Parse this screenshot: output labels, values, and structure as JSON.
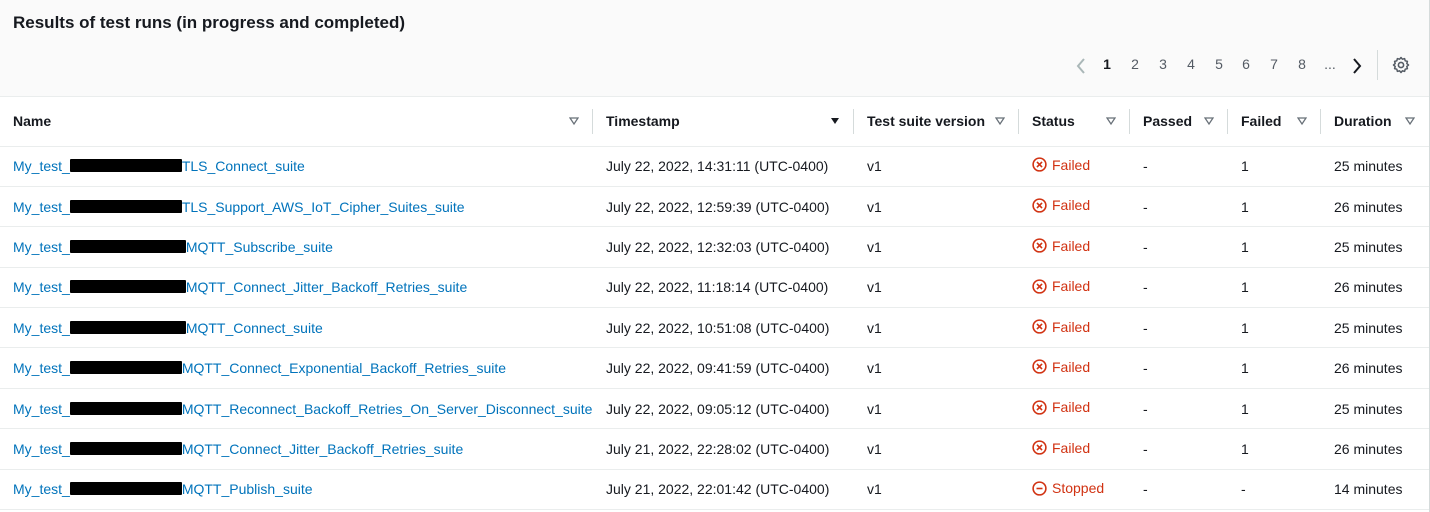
{
  "title": "Results of test runs (in progress and completed)",
  "pagination": {
    "pages": [
      "1",
      "2",
      "3",
      "4",
      "5",
      "6",
      "7",
      "8",
      "..."
    ],
    "current": "1"
  },
  "columns": {
    "name": "Name",
    "timestamp": "Timestamp",
    "version": "Test suite version",
    "status": "Status",
    "passed": "Passed",
    "failed": "Failed",
    "duration": "Duration"
  },
  "rows": [
    {
      "prefix": "My_test_",
      "suffix": "TLS_Connect_suite",
      "timestamp": "July 22, 2022, 14:31:11 (UTC-0400)",
      "version": "v1",
      "status": "Failed",
      "passed": "-",
      "failed": "1",
      "duration": "25 minutes"
    },
    {
      "prefix": "My_test_",
      "suffix": "TLS_Support_AWS_IoT_Cipher_Suites_suite",
      "timestamp": "July 22, 2022, 12:59:39 (UTC-0400)",
      "version": "v1",
      "status": "Failed",
      "passed": "-",
      "failed": "1",
      "duration": "26 minutes"
    },
    {
      "prefix": "My_test_",
      "suffix": "MQTT_Subscribe_suite",
      "timestamp": "July 22, 2022, 12:32:03 (UTC-0400)",
      "version": "v1",
      "status": "Failed",
      "passed": "-",
      "failed": "1",
      "duration": "25 minutes"
    },
    {
      "prefix": "My_test_",
      "suffix": "MQTT_Connect_Jitter_Backoff_Retries_suite",
      "timestamp": "July 22, 2022, 11:18:14 (UTC-0400)",
      "version": "v1",
      "status": "Failed",
      "passed": "-",
      "failed": "1",
      "duration": "26 minutes"
    },
    {
      "prefix": "My_test_",
      "suffix": "MQTT_Connect_suite",
      "timestamp": "July 22, 2022, 10:51:08 (UTC-0400)",
      "version": "v1",
      "status": "Failed",
      "passed": "-",
      "failed": "1",
      "duration": "25 minutes"
    },
    {
      "prefix": "My_test_",
      "suffix": "MQTT_Connect_Exponential_Backoff_Retries_suite",
      "timestamp": "July 22, 2022, 09:41:59 (UTC-0400)",
      "version": "v1",
      "status": "Failed",
      "passed": "-",
      "failed": "1",
      "duration": "26 minutes"
    },
    {
      "prefix": "My_test_",
      "suffix": "MQTT_Reconnect_Backoff_Retries_On_Server_Disconnect_suite",
      "timestamp": "July 22, 2022, 09:05:12 (UTC-0400)",
      "version": "v1",
      "status": "Failed",
      "passed": "-",
      "failed": "1",
      "duration": "25 minutes"
    },
    {
      "prefix": "My_test_",
      "suffix": "MQTT_Connect_Jitter_Backoff_Retries_suite",
      "timestamp": "July 21, 2022, 22:28:02 (UTC-0400)",
      "version": "v1",
      "status": "Failed",
      "passed": "-",
      "failed": "1",
      "duration": "26 minutes"
    },
    {
      "prefix": "My_test_",
      "suffix": "MQTT_Publish_suite",
      "timestamp": "July 21, 2022, 22:01:42 (UTC-0400)",
      "version": "v1",
      "status": "Stopped",
      "passed": "-",
      "failed": "-",
      "duration": "14 minutes"
    }
  ],
  "colors": {
    "link": "#0073bb",
    "error": "#d13212",
    "header_bg": "#fafafa"
  },
  "icons": {
    "failed": "x-circle-icon",
    "stopped": "minus-circle-icon",
    "sort": "caret-down-icon",
    "settings": "gear-icon"
  }
}
